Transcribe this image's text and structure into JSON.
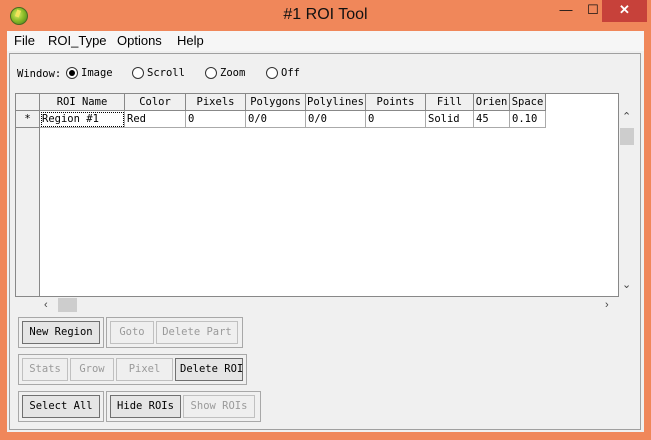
{
  "window": {
    "title": "#1 ROI Tool",
    "minimize_glyph": "—",
    "maximize_glyph": "☐",
    "close_glyph": "✕"
  },
  "menu": [
    "File",
    "ROI_Type",
    "Options",
    "Help"
  ],
  "window_mode": {
    "label": "Window:",
    "options": [
      {
        "label": "Image",
        "selected": true
      },
      {
        "label": "Scroll",
        "selected": false
      },
      {
        "label": "Zoom",
        "selected": false
      },
      {
        "label": "Off",
        "selected": false
      }
    ]
  },
  "table": {
    "columns": [
      "ROI Name",
      "Color",
      "Pixels",
      "Polygons",
      "Polylines",
      "Points",
      "Fill",
      "Orien",
      "Space"
    ],
    "rows": [
      {
        "marker": "*",
        "cells": [
          "Region #1",
          "Red",
          "0",
          "0/0",
          "0/0",
          "0",
          "Solid",
          "45",
          "0.10"
        ]
      }
    ]
  },
  "scroll_glyphs": {
    "up": "⌃",
    "down": "⌄",
    "left": "‹",
    "right": "›"
  },
  "buttons": {
    "new_region": "New Region",
    "goto": "Goto",
    "delete_part": "Delete Part",
    "stats": "Stats",
    "grow": "Grow",
    "pixel": "Pixel",
    "delete_roi": "Delete ROI",
    "select_all": "Select All",
    "hide_rois": "Hide ROIs",
    "show_rois": "Show ROIs"
  },
  "colors": {
    "frame": "#f0875a",
    "close_button": "#c7413a",
    "panel": "#f0f0f0"
  }
}
